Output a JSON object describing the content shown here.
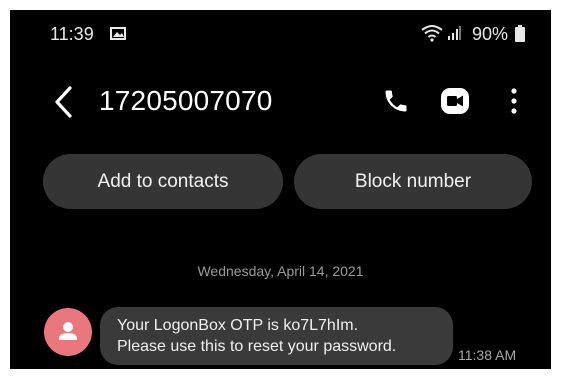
{
  "status_bar": {
    "time": "11:39",
    "battery": "90%",
    "icons": [
      "gallery-icon",
      "wifi-icon",
      "signal-icon",
      "battery-icon"
    ]
  },
  "header": {
    "contact_number": "17205007070",
    "icons": [
      "back-arrow-icon",
      "phone-icon",
      "video-call-icon",
      "more-vertical-icon"
    ]
  },
  "actions": {
    "add_to_contacts": "Add to contacts",
    "block_number": "Block number"
  },
  "conversation": {
    "date": "Wednesday, April 14, 2021",
    "messages": [
      {
        "lines": [
          "Your LogonBox OTP is ko7L7hIm.",
          "Please use this to reset your password."
        ],
        "time": "11:38 AM",
        "avatar_icon": "person-icon"
      }
    ]
  },
  "colors": {
    "background": "#000000",
    "button": "#353535",
    "bubble": "#3a3a3a",
    "avatar": "#e8777e",
    "secondary_text": "#9a9a9a"
  }
}
